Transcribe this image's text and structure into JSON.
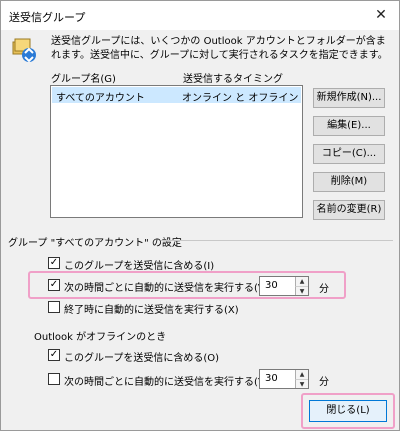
{
  "window": {
    "title": "送受信グループ",
    "close_glyph": "✕"
  },
  "description": "送受信グループには、いくつかの Outlook アカウントとフォルダーが含まれます。送受信中に、グループに対して実行されるタスクを指定できます。",
  "list": {
    "col_name": "グループ名(G)",
    "col_timing": "送受信するタイミング",
    "rows": [
      {
        "name": "すべてのアカウント",
        "timing": "オンライン と オフライン"
      }
    ]
  },
  "buttons": {
    "new": "新規作成(N)...",
    "edit": "編集(E)...",
    "copy": "コピー(C)...",
    "delete": "削除(M)",
    "rename": "名前の変更(R)",
    "close": "閉じる(L)"
  },
  "settings": {
    "group_label": "グループ \"すべてのアカウント\" の設定",
    "online": {
      "include": {
        "label": "このグループを送受信に含める(I)",
        "checked": true
      },
      "auto": {
        "label": "次の時間ごとに自動的に送受信を実行する(V)",
        "checked": true,
        "minutes": "30"
      },
      "on_exit": {
        "label": "終了時に自動的に送受信を実行する(X)",
        "checked": false
      }
    },
    "offline_title": "Outlook がオフラインのとき",
    "offline": {
      "include": {
        "label": "このグループを送受信に含める(O)",
        "checked": true
      },
      "auto": {
        "label": "次の時間ごとに自動的に送受信を実行する(Y)",
        "checked": false,
        "minutes": "30"
      }
    },
    "unit": "分"
  },
  "icons": {
    "app": "send-receive-icon",
    "check": "✓"
  }
}
